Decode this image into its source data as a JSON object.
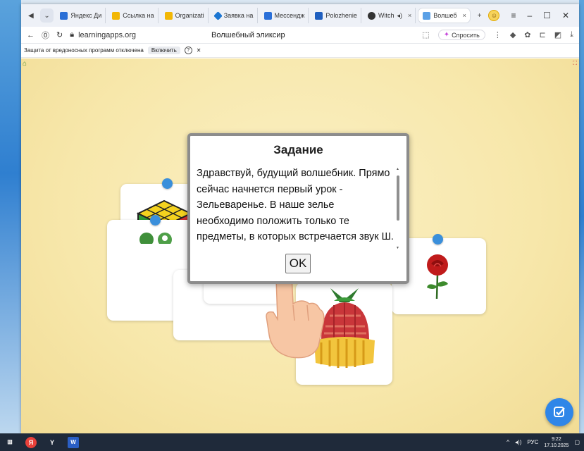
{
  "browser": {
    "tabs": [
      {
        "label": "Яндекс Ди",
        "color": "#2b6fd6"
      },
      {
        "label": "Ссылка на",
        "color": "#f2b705"
      },
      {
        "label": "Organizati",
        "color": "#f2b705"
      },
      {
        "label": "Заявка на",
        "color": "#1c76d2"
      },
      {
        "label": "Мессендж",
        "color": "#2a6fd8"
      },
      {
        "label": "Polozhenie",
        "color": "#1f5fbf"
      },
      {
        "label": "Witch",
        "color": "#333333"
      },
      {
        "label": "Волшеб",
        "color": "#5aa0e6"
      }
    ],
    "url": "learningapps.org",
    "page_title": "Волшебный эликсир",
    "ask_label": "Спросить",
    "protection_text": "Защита от вредоносных программ отключена",
    "protection_enable": "Включить"
  },
  "dialog": {
    "title": "Задание",
    "text": "Здравствуй, будущий волшебник. Прямо сейчас начнется первый урок - Зельеваренье. В наше зелье необходимо положить только те предметы, в которых встречается звук Ш. Соедини картинки со звуком Ш",
    "ok_label": "OK"
  },
  "taskbar": {
    "lang": "РУС",
    "time": "9:22",
    "date": "17.10.2025"
  }
}
